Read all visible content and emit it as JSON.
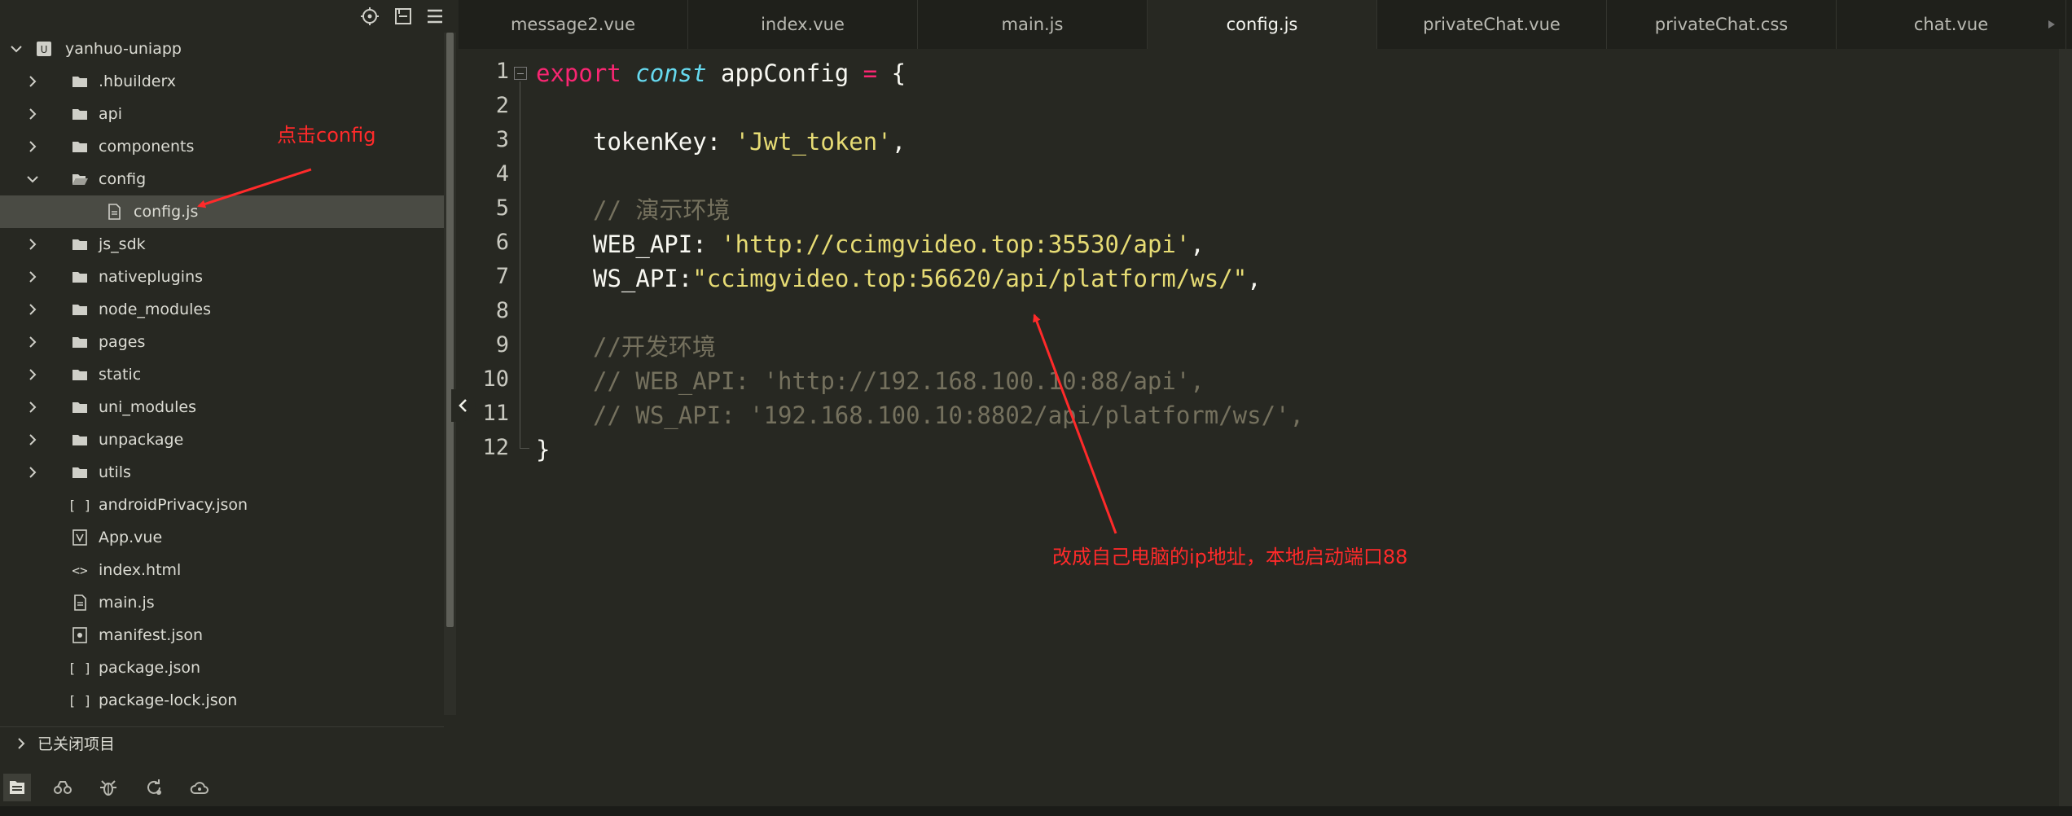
{
  "sidebar": {
    "project_name": "yanhuo-uniapp",
    "tree": [
      {
        "label": ".hbuilderx",
        "type": "folder",
        "chevron": "right"
      },
      {
        "label": "api",
        "type": "folder",
        "chevron": "right"
      },
      {
        "label": "components",
        "type": "folder",
        "chevron": "right"
      },
      {
        "label": "config",
        "type": "folder-open",
        "chevron": "down"
      },
      {
        "label": "config.js",
        "type": "js-file",
        "chevron": "none"
      },
      {
        "label": "js_sdk",
        "type": "folder",
        "chevron": "right"
      },
      {
        "label": "nativeplugins",
        "type": "folder",
        "chevron": "right"
      },
      {
        "label": "node_modules",
        "type": "folder",
        "chevron": "right"
      },
      {
        "label": "pages",
        "type": "folder",
        "chevron": "right"
      },
      {
        "label": "static",
        "type": "folder",
        "chevron": "right"
      },
      {
        "label": "uni_modules",
        "type": "folder",
        "chevron": "right"
      },
      {
        "label": "unpackage",
        "type": "folder",
        "chevron": "right"
      },
      {
        "label": "utils",
        "type": "folder",
        "chevron": "right"
      },
      {
        "label": "androidPrivacy.json",
        "type": "json-file",
        "chevron": "none"
      },
      {
        "label": "App.vue",
        "type": "vue-file",
        "chevron": "none"
      },
      {
        "label": "index.html",
        "type": "html-file",
        "chevron": "none"
      },
      {
        "label": "main.js",
        "type": "js-file",
        "chevron": "none"
      },
      {
        "label": "manifest.json",
        "type": "manifest-file",
        "chevron": "none"
      },
      {
        "label": "package.json",
        "type": "json-file",
        "chevron": "none"
      },
      {
        "label": "package-lock.json",
        "type": "json-file",
        "chevron": "none"
      }
    ],
    "selected": "config.js",
    "closed_projects_label": "已关闭项目",
    "toolbar_icons": [
      "locate-icon",
      "collapse-all-icon",
      "menu-icon"
    ],
    "bottom_icons": [
      "project-manager-icon",
      "search-binoculars-icon",
      "debug-bug-icon",
      "refresh-sync-icon",
      "cloud-icon"
    ]
  },
  "tabs": [
    {
      "label": "message2.vue",
      "active": false
    },
    {
      "label": "index.vue",
      "active": false
    },
    {
      "label": "main.js",
      "active": false
    },
    {
      "label": "config.js",
      "active": true
    },
    {
      "label": "privateChat.vue",
      "active": false
    },
    {
      "label": "privateChat.css",
      "active": false
    },
    {
      "label": "chat.vue",
      "active": false
    }
  ],
  "editor": {
    "line_numbers": [
      "1",
      "2",
      "3",
      "4",
      "5",
      "6",
      "7",
      "8",
      "9",
      "10",
      "11",
      "12"
    ],
    "lines": {
      "l1": {
        "kw": "export",
        "st": "const",
        "id": "appConfig",
        "op": "=",
        "pu": "{"
      },
      "l3": {
        "key": "tokenKey",
        "colon": ":",
        "str": "'Jwt_token'",
        "comma": ","
      },
      "l5": {
        "comment": "// 演示环境"
      },
      "l6": {
        "key": "WEB_API",
        "colon": ":",
        "str": "'http://ccimgvideo.top:35530/api'",
        "comma": ","
      },
      "l7": {
        "key": "WS_API",
        "colon": ":",
        "str": "\"ccimgvideo.top:56620/api/platform/ws/\"",
        "comma": ","
      },
      "l9": {
        "comment": "//开发环境"
      },
      "l10": {
        "comment": "// WEB_API: 'http://192.168.100.10:88/api',"
      },
      "l11": {
        "comment": "// WS_API: '192.168.100.10:8802/api/platform/ws/',"
      },
      "l12": {
        "pu": "}"
      }
    },
    "colors": {
      "background": "#272822",
      "keyword": "#f92672",
      "storage": "#66d9ef",
      "string": "#e6db74",
      "comment": "#75715e"
    }
  },
  "annotations": {
    "click_config": "点击config",
    "change_ip": "改成自己电脑的ip地址，本地启动端口88",
    "color": "#ff2a2a"
  }
}
